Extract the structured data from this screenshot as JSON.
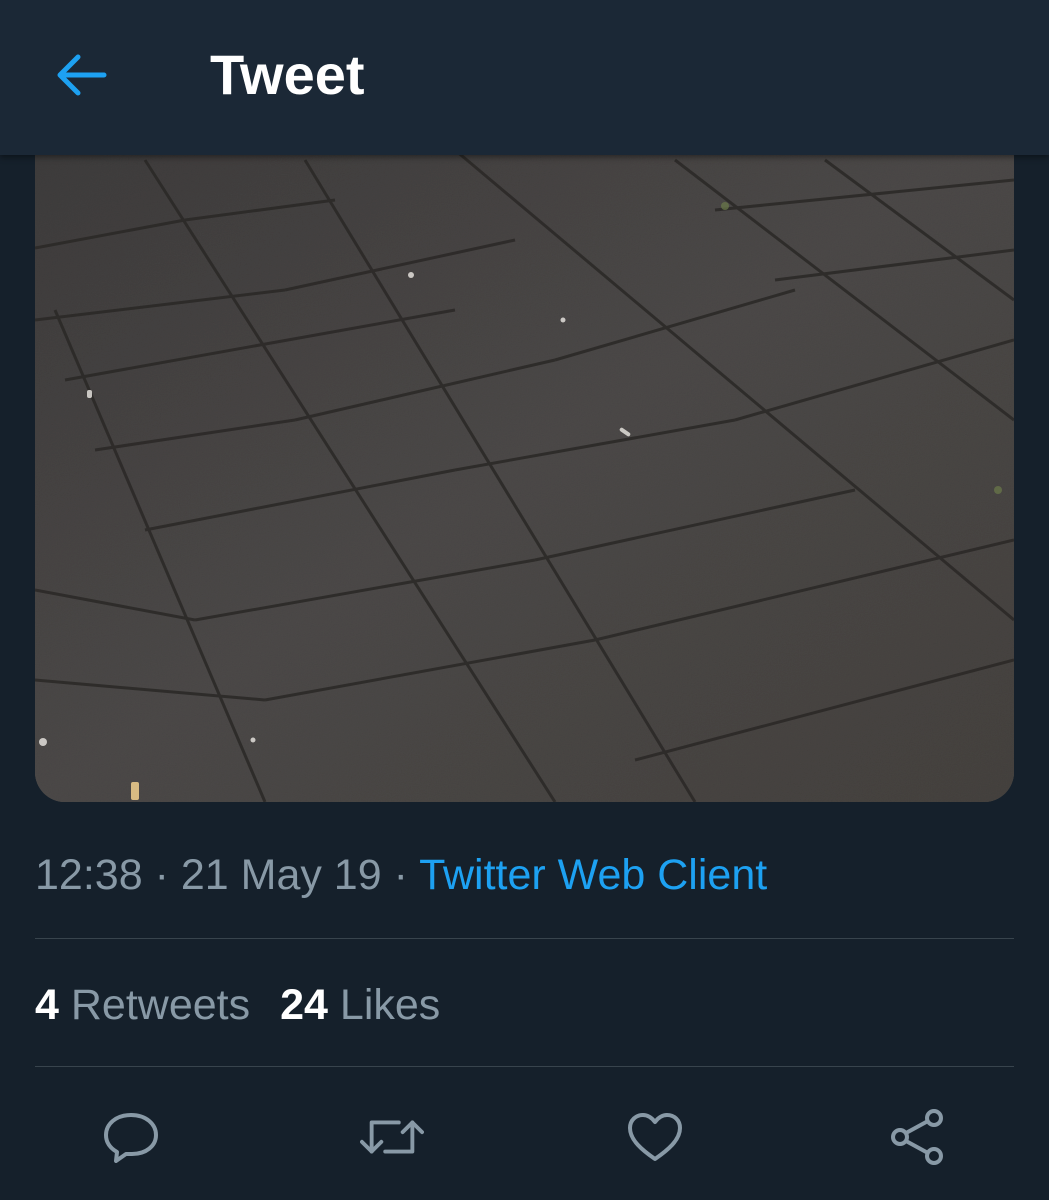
{
  "header": {
    "title": "Tweet",
    "back_icon": "arrow-left-icon",
    "accent_color": "#1da1f2"
  },
  "tweet": {
    "media": {
      "icon": "photo-of-paving-stones"
    },
    "time": "12:38",
    "date": "21 May 19",
    "separator": "·",
    "source": "Twitter Web Client",
    "stats": {
      "retweets_count": "4",
      "retweets_label": "Retweets",
      "likes_count": "24",
      "likes_label": "Likes"
    },
    "actions": [
      {
        "name": "reply",
        "icon": "comment-icon"
      },
      {
        "name": "retweet",
        "icon": "retweet-icon"
      },
      {
        "name": "like",
        "icon": "heart-icon"
      },
      {
        "name": "share",
        "icon": "share-icon"
      }
    ]
  },
  "colors": {
    "background": "#15202b",
    "header": "#1b2836",
    "secondary_text": "#8899a6",
    "link": "#1da1f2",
    "divider": "#38444d"
  }
}
